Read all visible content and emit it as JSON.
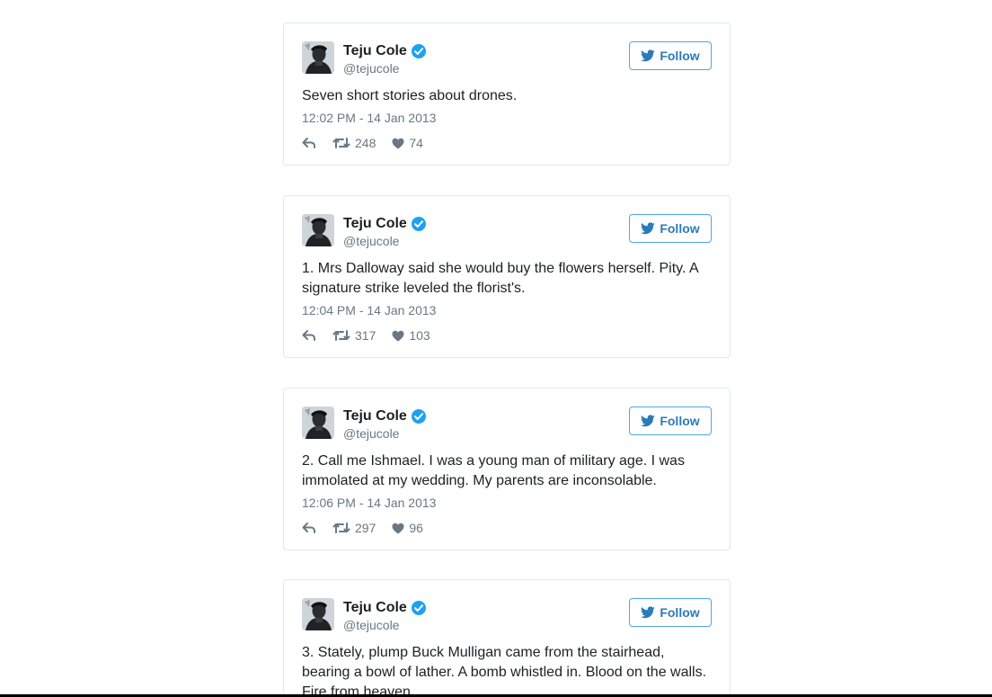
{
  "colors": {
    "link_blue": "#2b7bb9",
    "verified_blue": "#1da1f2",
    "muted_gray": "#697882",
    "text": "#1c2022",
    "border": "#e1e8ed"
  },
  "icons": {
    "verified": "verified-badge-icon",
    "follow_bird": "twitter-bird-icon",
    "reply": "reply-icon",
    "retweet": "retweet-icon",
    "like": "heart-icon"
  },
  "tweets": [
    {
      "author_name": "Teju Cole",
      "author_handle": "@tejucole",
      "follow_label": "Follow",
      "text": "Seven short stories about drones.",
      "timestamp": "12:02 PM - 14 Jan 2013",
      "retweets": "248",
      "likes": "74"
    },
    {
      "author_name": "Teju Cole",
      "author_handle": "@tejucole",
      "follow_label": "Follow",
      "text": "1. Mrs Dalloway said she would buy the flowers herself. Pity. A signature strike leveled the florist's.",
      "timestamp": "12:04 PM - 14 Jan 2013",
      "retweets": "317",
      "likes": "103"
    },
    {
      "author_name": "Teju Cole",
      "author_handle": "@tejucole",
      "follow_label": "Follow",
      "text": "2. Call me Ishmael. I was a young man of military age. I was immolated at my wedding. My parents are inconsolable.",
      "timestamp": "12:06 PM - 14 Jan 2013",
      "retweets": "297",
      "likes": "96"
    },
    {
      "author_name": "Teju Cole",
      "author_handle": "@tejucole",
      "follow_label": "Follow",
      "text": "3. Stately, plump Buck Mulligan came from the stairhead, bearing a bowl of lather. A bomb whistled in. Blood on the walls. Fire from heaven."
    }
  ]
}
